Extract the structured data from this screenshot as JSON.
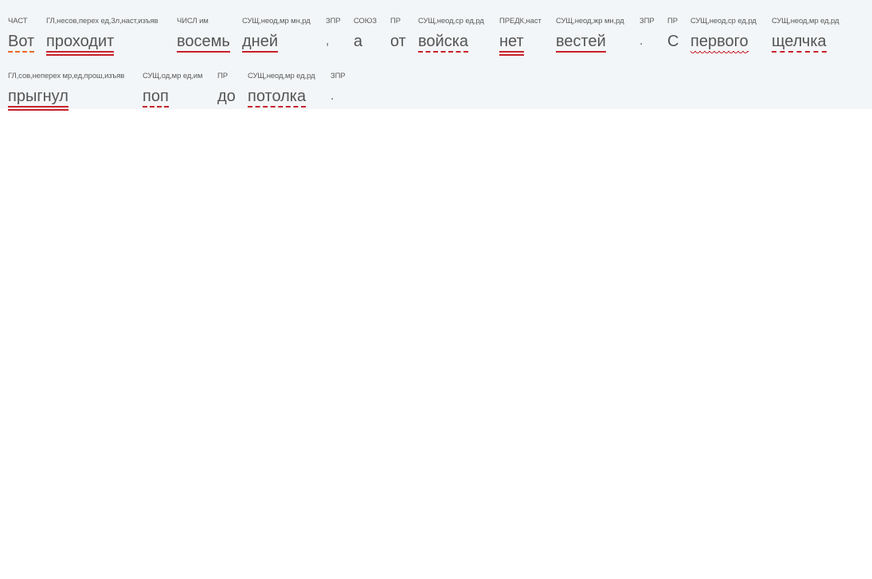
{
  "lines": [
    [
      {
        "tag": "ЧАСТ",
        "word": "Вот",
        "underline": "dashdot"
      },
      {
        "tag": "ГЛ,несов,перех ед,3л,наст,изъяв",
        "word": "проходит",
        "underline": "double"
      },
      {
        "tag": "ЧИСЛ им",
        "word": "восемь",
        "underline": "single"
      },
      {
        "tag": "СУЩ,неод,мр мн,рд",
        "word": "дней",
        "underline": "single"
      },
      {
        "tag": "ЗПР",
        "word": ",",
        "underline": "none"
      },
      {
        "tag": "СОЮЗ",
        "word": "а",
        "underline": "none"
      },
      {
        "tag": "ПР",
        "word": "от",
        "underline": "none"
      },
      {
        "tag": "СУЩ,неод,ср ед,рд",
        "word": "войска",
        "underline": "dashed"
      },
      {
        "tag": "ПРЕДК,наст",
        "word": "нет",
        "underline": "double"
      },
      {
        "tag": "СУЩ,неод,жр мн,рд",
        "word": "вестей",
        "underline": "single"
      },
      {
        "tag": "ЗПР",
        "word": ".",
        "underline": "none"
      },
      {
        "tag": "ПР",
        "word": "С",
        "underline": "none"
      },
      {
        "tag": "СУЩ,неод,ср ед,рд",
        "word": "первого",
        "underline": "wavy"
      },
      {
        "tag": "СУЩ,неод,мр ед,рд",
        "word": "щелчка",
        "underline": "dashed"
      }
    ],
    [
      {
        "tag": "ГЛ,сов,неперех мр,ед,прош,изъяв",
        "word": "прыгнул",
        "underline": "double"
      },
      {
        "tag": "СУЩ,од,мр ед,им",
        "word": "поп",
        "underline": "dashed"
      },
      {
        "tag": "ПР",
        "word": "до",
        "underline": "none"
      },
      {
        "tag": "СУЩ,неод,мр ед,рд",
        "word": "потолка",
        "underline": "dashed"
      },
      {
        "tag": "ЗПР",
        "word": ".",
        "underline": "none"
      }
    ]
  ]
}
